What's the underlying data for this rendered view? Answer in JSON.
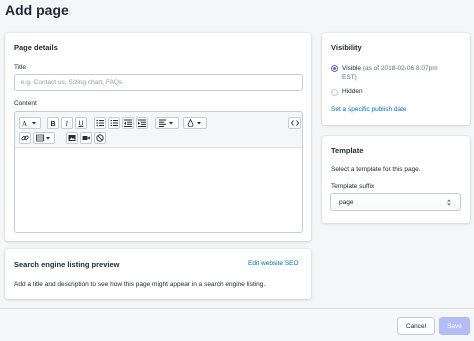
{
  "header": {
    "title": "Add page"
  },
  "page_details": {
    "heading": "Page details",
    "title_label": "Title",
    "title_placeholder": "e.g. Contact us, Sizing chart, FAQs",
    "title_value": "",
    "content_label": "Content",
    "toolbar": {
      "row1": [
        "font-size-icon",
        "bold-icon",
        "italic-icon",
        "underline-icon",
        "bullet-list-icon",
        "numbered-list-icon",
        "outdent-icon",
        "indent-icon",
        "align-icon",
        "text-color-icon",
        "code-view-icon"
      ],
      "row2": [
        "link-icon",
        "table-icon",
        "image-icon",
        "video-icon",
        "clear-format-icon"
      ]
    }
  },
  "visibility": {
    "heading": "Visibility",
    "options": [
      {
        "label": "Visible",
        "detail": "(as of 2018-02-06 8:07pm",
        "detail2": "EST)",
        "checked": true
      },
      {
        "label": "Hidden",
        "checked": false
      }
    ],
    "publish_link": "Set a specific publish date"
  },
  "template": {
    "heading": "Template",
    "description": "Select a template for this page.",
    "suffix_label": "Template suffix",
    "suffix_value": "page"
  },
  "seo": {
    "heading": "Search engine listing preview",
    "edit_link": "Edit website SEO",
    "description": "Add a title and description to see how this page might appear in a search engine listing."
  },
  "footer": {
    "cancel_label": "Cancel",
    "save_label": "Save"
  },
  "colors": {
    "accent": "#5c6ac4",
    "link": "#006fbb",
    "save_disabled": "#b3bcf5"
  }
}
